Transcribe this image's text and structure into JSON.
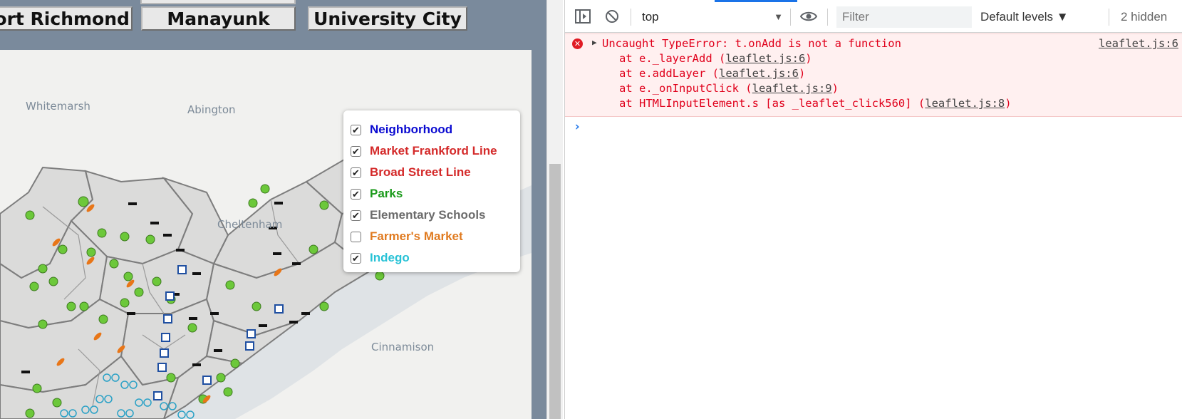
{
  "nav": {
    "buttons": [
      "Port Richmond",
      "Manayunk",
      "University City"
    ]
  },
  "map": {
    "place_labels": [
      "Whitemarsh",
      "Abington",
      "Cheltenham",
      "Cinnamison"
    ],
    "layer_control": {
      "layers": [
        {
          "label": "Neighborhood",
          "checked": true,
          "color": "#0a0ad1"
        },
        {
          "label": "Market Frankford Line",
          "checked": true,
          "color": "#d42a2a"
        },
        {
          "label": "Broad Street Line",
          "checked": true,
          "color": "#d42a2a"
        },
        {
          "label": "Parks",
          "checked": true,
          "color": "#1a9a1a"
        },
        {
          "label": "Elementary Schools",
          "checked": true,
          "color": "#6b6b6b"
        },
        {
          "label": "Farmer's Market",
          "checked": false,
          "color": "#e07a1f"
        },
        {
          "label": "Indego",
          "checked": true,
          "color": "#28c2d6"
        }
      ]
    },
    "marker_icons": [
      "tree-icon",
      "carrot-icon",
      "graduation-cap-icon",
      "septa-icon",
      "bike-icon"
    ]
  },
  "devtools": {
    "context": "top",
    "filter_placeholder": "Filter",
    "levels": "Default levels ▼",
    "hidden": "2 hidden",
    "error": {
      "message": "Uncaught TypeError: t.onAdd is not a function",
      "source": "leaflet.js:6",
      "stack": [
        {
          "prefix": "at e._layerAdd (",
          "link": "leaflet.js:6",
          "suffix": ")"
        },
        {
          "prefix": "at e.addLayer (",
          "link": "leaflet.js:6",
          "suffix": ")"
        },
        {
          "prefix": "at e._onInputClick (",
          "link": "leaflet.js:9",
          "suffix": ")"
        },
        {
          "prefix": "at HTMLInputElement.s [as _leaflet_click560] (",
          "link": "leaflet.js:8",
          "suffix": ")"
        }
      ]
    },
    "prompt": "›"
  }
}
